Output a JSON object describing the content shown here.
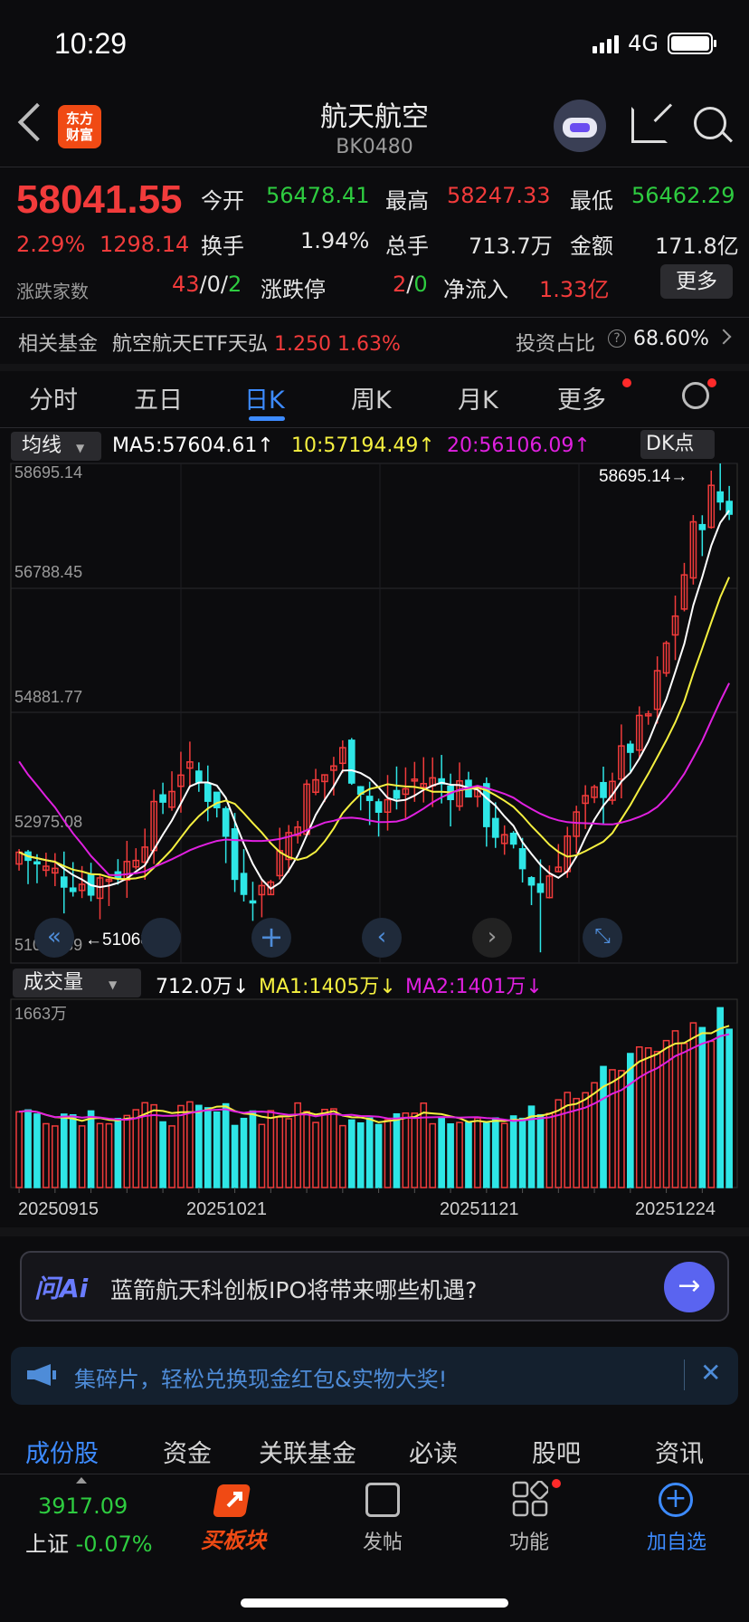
{
  "status": {
    "time": "10:29",
    "network": "4G"
  },
  "header": {
    "title": "航天航空",
    "code": "BK0480",
    "logo_text": "东方\n财富"
  },
  "quote": {
    "price": "58041.55",
    "change_pct": "2.29%",
    "change": "1298.14",
    "open_label": "今开",
    "open": "56478.41",
    "high_label": "最高",
    "high": "58247.33",
    "low_label": "最低",
    "low": "56462.29",
    "turnover_label": "换手",
    "turnover": "1.94%",
    "volume_label": "总手",
    "volume": "713.7万",
    "amount_label": "金额",
    "amount": "171.8亿",
    "breadth_label": "涨跌家数",
    "breadth_up": "43",
    "breadth_flat": "0",
    "breadth_down": "2",
    "limit_label": "涨跌停",
    "limit_up": "2",
    "limit_down": "0",
    "inflow_label": "净流入",
    "inflow": "1.33亿",
    "more_button": "更多"
  },
  "fund": {
    "label": "相关基金",
    "name": "航空航天ETF天弘",
    "price": "1.250",
    "pct": "1.63%",
    "ratio_label": "投资占比",
    "ratio": "68.60%"
  },
  "tabs": [
    "分时",
    "五日",
    "日K",
    "周K",
    "月K",
    "更多"
  ],
  "kline": {
    "ma_select": "均线",
    "ma5": "MA5:57604.61↑",
    "ma10": "10:57194.49↑",
    "ma20": "20:56106.09↑",
    "dk_button": "DK点",
    "y_ticks": [
      "58695.14",
      "56788.45",
      "54881.77",
      "52975.08",
      "51068.39"
    ],
    "max_label": "58695.14→",
    "min_label": "←51068.39",
    "colors": {
      "up": "#f23b3b",
      "down": "#2ee6e6",
      "ma5": "#ffffff",
      "ma10": "#f5f040",
      "ma20": "#e020e0"
    }
  },
  "volume": {
    "select": "成交量",
    "current": "712.0万↓",
    "ma1": "MA1:1405万↓",
    "ma2": "MA2:1401万↓",
    "y_max": "1663万",
    "dates": [
      "20250915",
      "20251021",
      "20251121",
      "20251224"
    ]
  },
  "ask_ai": {
    "brand": "问Ai",
    "question": "蓝箭航天科创板IPO将带来哪些机遇?"
  },
  "notice": {
    "text": "集碎片，轻松兑换现金红包&实物大奖!"
  },
  "bottom_tabs": [
    "成份股",
    "资金",
    "关联基金",
    "必读",
    "股吧",
    "资讯"
  ],
  "nav": {
    "index_value": "3917.09",
    "index_name": "上证",
    "index_pct": "-0.07%",
    "buy": "买板块",
    "post": "发帖",
    "func": "功能",
    "add": "加自选"
  },
  "chart_data": [
    {
      "type": "candlestick",
      "title": "",
      "y_ticks": [
        58695.14,
        56788.45,
        54881.77,
        52975.08,
        51068.39
      ],
      "ylim": [
        51068.39,
        58695.14
      ],
      "x_ticks": [
        "20250915",
        "20251021",
        "20251121",
        "20251224"
      ],
      "series": [
        {
          "name": "MA5",
          "last": 57604.61
        },
        {
          "name": "10",
          "last": 57194.49
        },
        {
          "name": "20",
          "last": 56106.09
        }
      ],
      "annotations": [
        "58695.14→",
        "←51068.39"
      ]
    },
    {
      "type": "bar",
      "title": "",
      "ylim_top_label": "1663万",
      "series": [
        {
          "name": "MA1",
          "last": "1405万"
        },
        {
          "name": "MA2",
          "last": "1401万"
        }
      ],
      "current": "712.0万"
    }
  ]
}
